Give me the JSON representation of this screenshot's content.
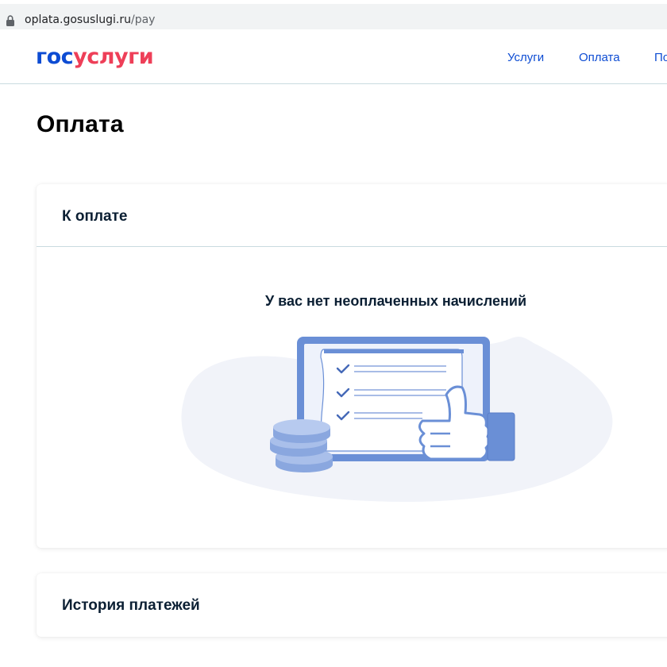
{
  "browser": {
    "url_host": "oplata.gosuslugi.ru",
    "url_path": "/pay"
  },
  "header": {
    "logo_part1": "гос",
    "logo_part2": "услуги",
    "nav": [
      {
        "label": "Услуги"
      },
      {
        "label": "Оплата"
      },
      {
        "label": "По"
      }
    ]
  },
  "page": {
    "title": "Оплата"
  },
  "to_pay": {
    "title": "К оплате",
    "empty_message": "У вас нет неоплаченных начислений"
  },
  "history": {
    "title": "История платежей"
  },
  "colors": {
    "brand_blue": "#0d4cd3",
    "brand_red": "#ee3f58",
    "illustration_blue": "#6a8fd6",
    "illustration_bg": "#f1f3f9"
  }
}
